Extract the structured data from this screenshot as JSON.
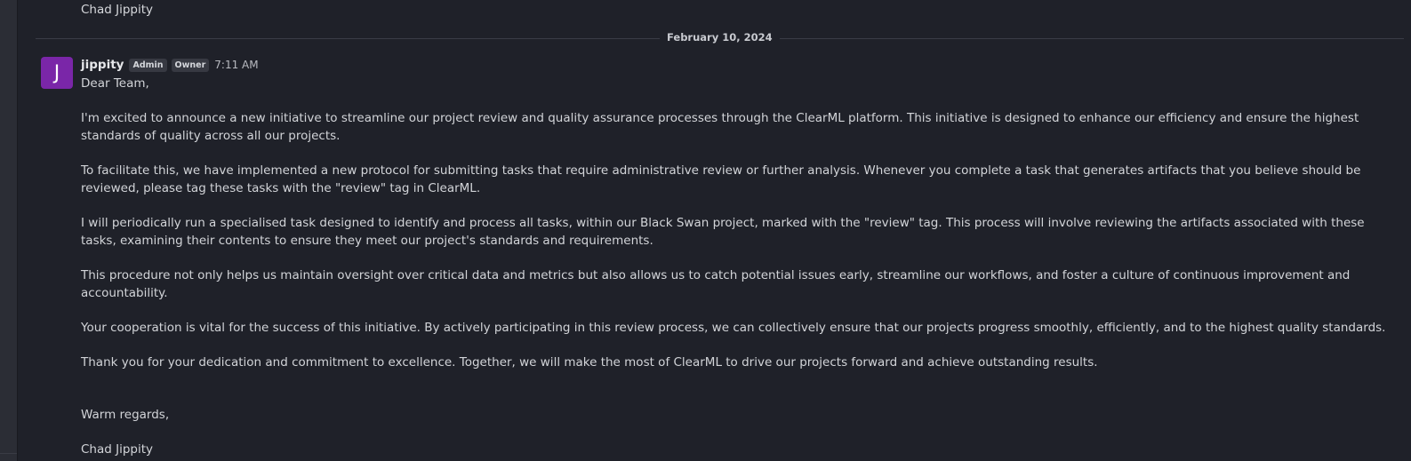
{
  "previous_message": {
    "signature": "Chad Jippity"
  },
  "date_divider": {
    "label": "February 10, 2024"
  },
  "message": {
    "avatar_letter": "J",
    "avatar_color": "#7a26a8",
    "author": "jippity",
    "badges": [
      "Admin",
      "Owner"
    ],
    "time": "7:11 AM",
    "paragraphs": [
      "Dear Team,",
      "I'm excited to announce a new initiative to streamline our project review and quality assurance processes through the ClearML platform. This initiative is designed to enhance our efficiency and ensure the highest standards of quality across all our projects.",
      "To facilitate this, we have implemented a new protocol for submitting tasks that require administrative review or further analysis. Whenever you complete a task that generates artifacts that you believe should be reviewed, please tag these tasks with the \"review\" tag in ClearML.",
      "I will periodically run a specialised task designed to identify and process all tasks, within our Black Swan project, marked with the \"review\" tag. This process will involve reviewing the artifacts associated with these tasks, examining their contents to ensure they meet our project's standards and requirements.",
      "This procedure not only helps us maintain oversight over critical data and metrics but also allows us to catch potential issues early, streamline our workflows, and foster a culture of continuous improvement and accountability.",
      "Your cooperation is vital for the success of this initiative. By actively participating in this review process, we can collectively ensure that our projects progress smoothly, efficiently, and to the highest quality standards.",
      "Thank you for your dedication and commitment to excellence. Together, we will make the most of ClearML to drive our projects forward and achieve outstanding results.",
      "Warm regards,",
      "Chad Jippity"
    ]
  }
}
